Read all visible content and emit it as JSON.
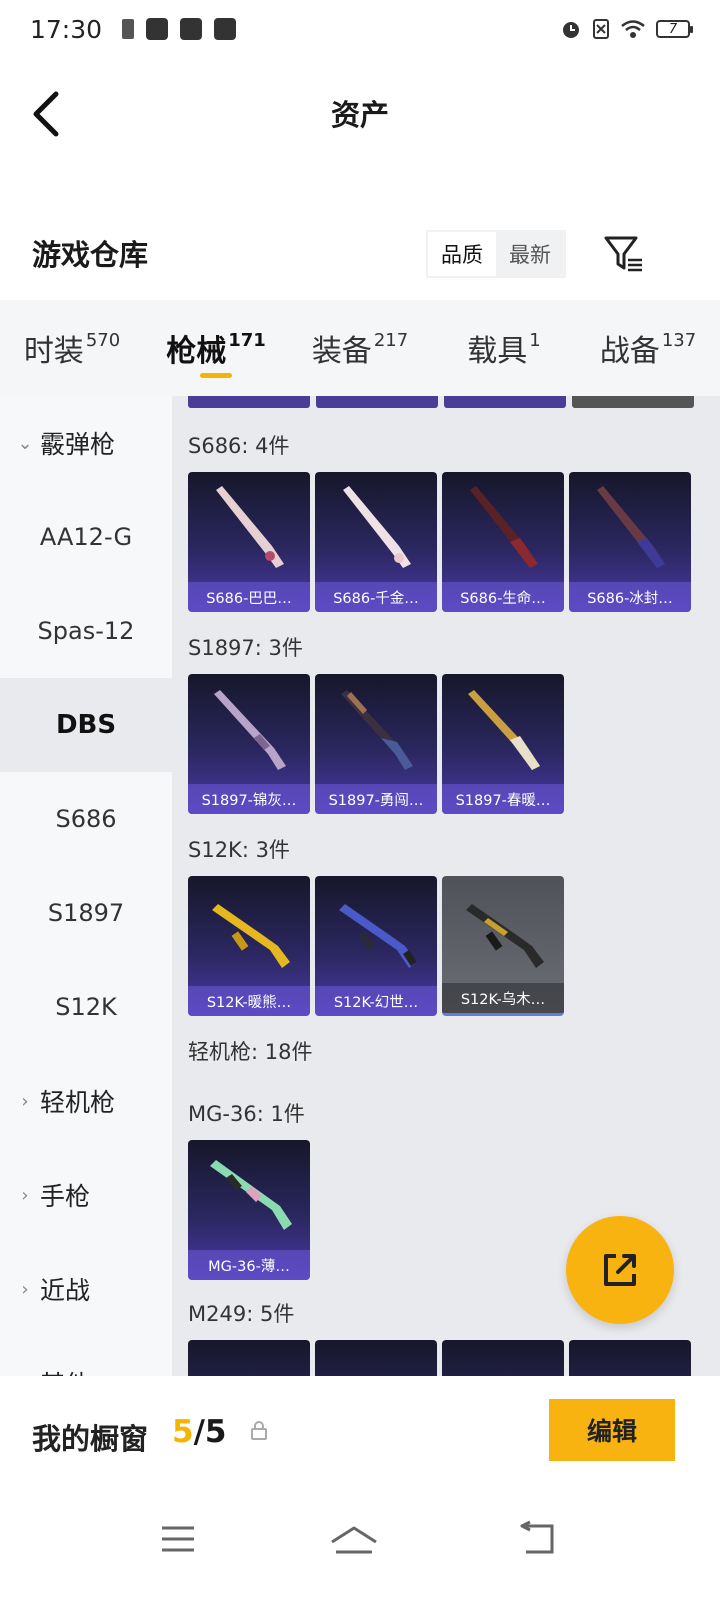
{
  "status_bar": {
    "time": "17:30",
    "battery": "7"
  },
  "header": {
    "title": "资产"
  },
  "warehouse": {
    "title": "游戏仓库",
    "sort_options": [
      "品质",
      "最新"
    ],
    "sort_selected": "品质"
  },
  "tabs": [
    {
      "label": "时装",
      "count": "570"
    },
    {
      "label": "枪械",
      "count": "171"
    },
    {
      "label": "装备",
      "count": "217"
    },
    {
      "label": "载具",
      "count": "1"
    },
    {
      "label": "战备",
      "count": "137"
    }
  ],
  "active_tab": "枪械",
  "sidebar": {
    "items": [
      {
        "label": "霰弹枪",
        "group": true,
        "expanded": true
      },
      {
        "label": "AA12-G"
      },
      {
        "label": "Spas-12"
      },
      {
        "label": "DBS",
        "active": true
      },
      {
        "label": "S686"
      },
      {
        "label": "S1897"
      },
      {
        "label": "S12K"
      },
      {
        "label": "轻机枪",
        "group": true
      },
      {
        "label": "手枪",
        "group": true
      },
      {
        "label": "近战",
        "group": true
      },
      {
        "label": "其他",
        "group": true
      }
    ]
  },
  "groups": [
    {
      "label": "S686: 4件",
      "items": [
        "S686-巴巴…",
        "S686-千金…",
        "S686-生命…",
        "S686-冰封…"
      ]
    },
    {
      "label": "S1897: 3件",
      "items": [
        "S1897-锦灰…",
        "S1897-勇闯…",
        "S1897-春暖…"
      ]
    },
    {
      "label": "S12K: 3件",
      "items": [
        "S12K-暖熊…",
        "S12K-幻世…",
        "S12K-乌木…"
      ]
    },
    {
      "label": "轻机枪: 18件",
      "items": []
    },
    {
      "label": "MG-36: 1件",
      "items": [
        "MG-36-薄…"
      ]
    },
    {
      "label": "M249: 5件",
      "items": []
    }
  ],
  "showcase": {
    "label": "我的橱窗",
    "current": "5",
    "total": "/5",
    "edit_label": "编辑"
  },
  "colors": {
    "accent": "#f9b311",
    "card_purple": "#4a3aa8"
  }
}
